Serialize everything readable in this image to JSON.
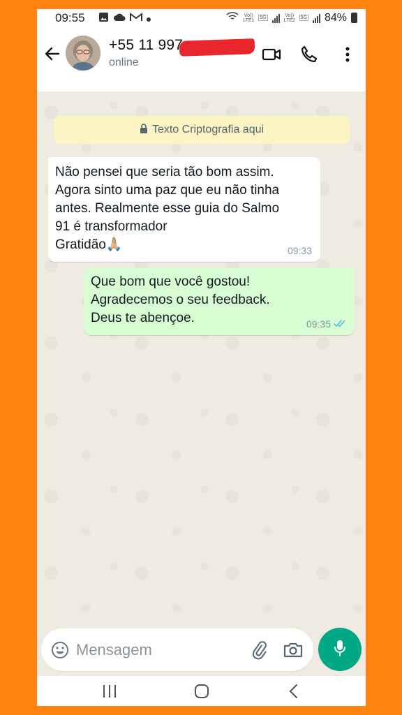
{
  "status_bar": {
    "time": "09:55",
    "net1": "Vo)) LTE1",
    "net2": "Vo)) LTE2",
    "sim_tag": "5G",
    "battery": "84%"
  },
  "header": {
    "contact_name": "+55 11 997",
    "contact_status": "online"
  },
  "chat": {
    "encryption_notice": "Texto Criptografia aqui",
    "messages": [
      {
        "direction": "incoming",
        "text": "Não pensei que seria tão bom assim.\nAgora sinto uma paz que eu não tinha\nantes. Realmente esse  guia do Salmo\n91 é transformador\nGratidão🙏🏼",
        "time": "09:33"
      },
      {
        "direction": "outgoing",
        "text": "Que bom que você gostou!\nAgradecemos o seu feedback.\nDeus te abençoe.",
        "time": "09:35"
      }
    ]
  },
  "input": {
    "placeholder": "Mensagem"
  },
  "colors": {
    "frame": "#FF8311",
    "chat_bg": "#EFEAE2",
    "outgoing_bubble": "#D9FDD3",
    "encryption_bg": "#FDF4C5",
    "accent": "#00A884",
    "read_ticks": "#53BDEB"
  },
  "icons": [
    "back-arrow-icon",
    "video-call-icon",
    "phone-icon",
    "more-vert-icon",
    "lock-icon",
    "double-check-icon",
    "emoji-icon",
    "attach-icon",
    "camera-icon",
    "mic-icon",
    "recent-apps-icon",
    "home-icon",
    "nav-back-icon"
  ]
}
